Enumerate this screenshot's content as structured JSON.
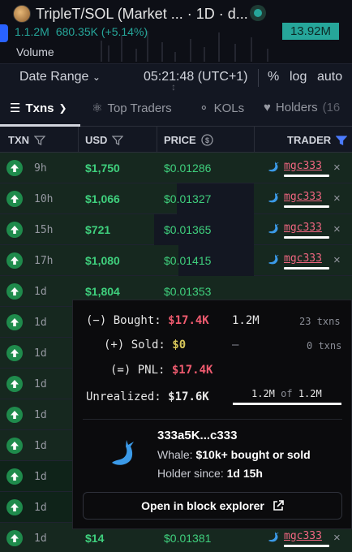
{
  "header": {
    "title": "TripleT/SOL (Market ... · 1D · d...",
    "volume_value": "1.1.2M",
    "volume_change": "680.35K (+5.14%)",
    "price_badge": "13.92M",
    "volume_label": "Volume",
    "colors": {
      "green": "#26a69a",
      "accent": "#2962ff"
    }
  },
  "range_bar": {
    "date_range": "Date Range",
    "time": "05:21:48 (UTC+1)",
    "percent": "%",
    "log": "log",
    "auto": "auto"
  },
  "tabs": [
    {
      "label": "Txns",
      "icon": "list-icon",
      "active": true
    },
    {
      "label": "Top Traders",
      "icon": "trophy-icon"
    },
    {
      "label": "KOLs",
      "icon": "microphone-icon"
    },
    {
      "label": "Holders",
      "count": "(16",
      "icon": "heart-icon"
    }
  ],
  "table": {
    "headers": [
      "TXN",
      "USD",
      "PRICE",
      "TRADER"
    ],
    "rows": [
      {
        "age": "9h",
        "usd": "$1,750",
        "price": "$0.01286",
        "trader": "mgc333",
        "fill": 0
      },
      {
        "age": "10h",
        "usd": "$1,066",
        "price": "$0.01327",
        "trader": "mgc333",
        "fill": 0.61
      },
      {
        "age": "15h",
        "usd": "$721",
        "price": "$0.01365",
        "trader": "mgc333",
        "fill": 0.41
      },
      {
        "age": "17h",
        "usd": "$1,080",
        "price": "$0.01415",
        "trader": "mgc333",
        "fill": 0.62
      },
      {
        "age": "1d",
        "usd": "$1,804",
        "price": "$0.01353",
        "trader": "",
        "fill": 0
      },
      {
        "age": "1d",
        "usd": "",
        "price": "",
        "trader": "",
        "fill": 0
      },
      {
        "age": "1d",
        "usd": "",
        "price": "",
        "trader": "",
        "fill": 0
      },
      {
        "age": "1d",
        "usd": "",
        "price": "",
        "trader": "",
        "fill": 0
      },
      {
        "age": "1d",
        "usd": "",
        "price": "",
        "trader": "",
        "fill": 0
      },
      {
        "age": "1d",
        "usd": "",
        "price": "",
        "trader": "",
        "fill": 0
      },
      {
        "age": "1d",
        "usd": "",
        "price": "",
        "trader": "",
        "fill": 0
      },
      {
        "age": "1d",
        "usd": "",
        "price": "",
        "trader": "",
        "fill": 0
      },
      {
        "age": "1d",
        "usd": "$14",
        "price": "$0.01381",
        "trader": "mgc333",
        "fill": 0
      }
    ]
  },
  "popup": {
    "bought_label": "(−) Bought:",
    "bought_value": "$17.4K",
    "bought_amount": "1.2M",
    "bought_txns": "23 txns",
    "sold_label": "(+) Sold:",
    "sold_value": "$0",
    "sold_amount": "–",
    "sold_txns": "0 txns",
    "pnl_label": "(=) PNL:",
    "pnl_value": "$17.4K",
    "unrealized_label": "Unrealized:",
    "unrealized_value": "$17.6K",
    "held_amount": "1.2M",
    "held_of": "of",
    "held_total": "1.2M",
    "held_fraction": 1.0,
    "address": "333a5K...c333",
    "whale_prefix": "Whale:",
    "whale_desc": "$10k+ bought or sold",
    "holder_prefix": "Holder since:",
    "holder_since": "1d 15h",
    "explorer_button": "Open in block explorer"
  }
}
